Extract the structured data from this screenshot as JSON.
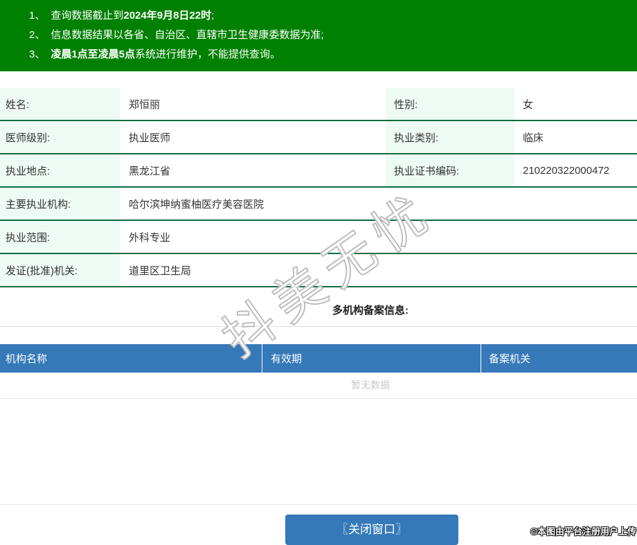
{
  "notice": {
    "items": [
      {
        "num": "1、",
        "pre": "查询数据截止到",
        "bold": "2024年9月8日22时",
        "post": ";"
      },
      {
        "num": "2、",
        "pre": "信息数据结果以各省、自治区、直辖市卫生健康委数据为准;",
        "bold": "",
        "post": ""
      },
      {
        "num": "3、",
        "pre": "",
        "bold": "凌晨1点至凌晨5点",
        "post": "系统进行维护，不能提供查询。"
      }
    ]
  },
  "info": {
    "rows": [
      {
        "label1": "姓名:",
        "value1": "郑恒丽",
        "label2": "性别:",
        "value2": "女"
      },
      {
        "label1": "医师级别:",
        "value1": "执业医师",
        "label2": "执业类别:",
        "value2": "临床"
      },
      {
        "label1": "执业地点:",
        "value1": "黑龙江省",
        "label2": "执业证书编码:",
        "value2": "210220322000472"
      },
      {
        "label1": "主要执业机构:",
        "value1": "哈尔滨坤纳蜜柚医疗美容医院"
      },
      {
        "label1": "执业范围:",
        "value1": "外科专业"
      },
      {
        "label1": "发证(批准)机关:",
        "value1": "道里区卫生局"
      }
    ]
  },
  "filing": {
    "title": "多机构备案信息:",
    "columns": [
      "机构名称",
      "有效期",
      "备案机关"
    ],
    "empty_text": "暂无数据"
  },
  "watermark": {
    "text": "抖美无忧"
  },
  "footer": {
    "close_button": "〖关闭窗口〗",
    "stamp": "©本图由平台注册用户上传"
  },
  "colors": {
    "notice_green": "#008000",
    "label_mint": "#eefaf4",
    "row_border_green": "#0a6b40",
    "accent_blue": "#3579b8",
    "empty_gray": "#c9c9c9"
  }
}
